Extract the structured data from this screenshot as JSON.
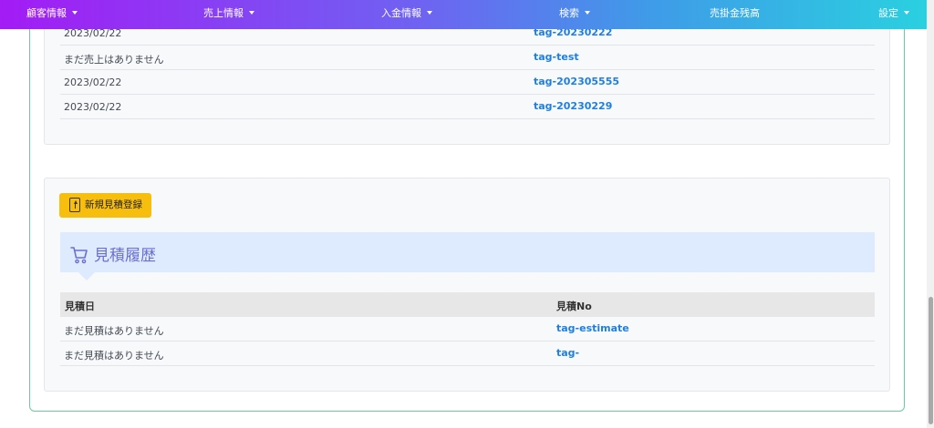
{
  "nav": {
    "items": [
      {
        "label": "顧客情報",
        "dropdown": true
      },
      {
        "label": "売上情報",
        "dropdown": true
      },
      {
        "label": "入金情報",
        "dropdown": true
      },
      {
        "label": "検索",
        "dropdown": true
      },
      {
        "label": "売掛金残高",
        "dropdown": false
      },
      {
        "label": "設定",
        "dropdown": true
      }
    ]
  },
  "sales_rows": [
    {
      "date": "2023/02/22",
      "tag": "tag-20230222"
    },
    {
      "date": "まだ売上はありません",
      "tag": "tag-test"
    },
    {
      "date": "2023/02/22",
      "tag": "tag-202305555"
    },
    {
      "date": "2023/02/22",
      "tag": "tag-20230229"
    }
  ],
  "estimate": {
    "new_button_label": "新規見積登録",
    "title": "見積履歴",
    "columns": [
      "見積日",
      "見積No"
    ],
    "rows": [
      {
        "date": "まだ見積はありません",
        "no": "tag-estimate"
      },
      {
        "date": "まだ見積はありません",
        "no": "tag-"
      }
    ]
  },
  "colors": {
    "nav_gradient_start": "#a31bf5",
    "nav_gradient_end": "#2ad0e0",
    "link": "#1f7fe0",
    "button_yellow": "#f8be0d",
    "section_title": "#6a6fd0",
    "card_border": "#6cc9a2"
  }
}
